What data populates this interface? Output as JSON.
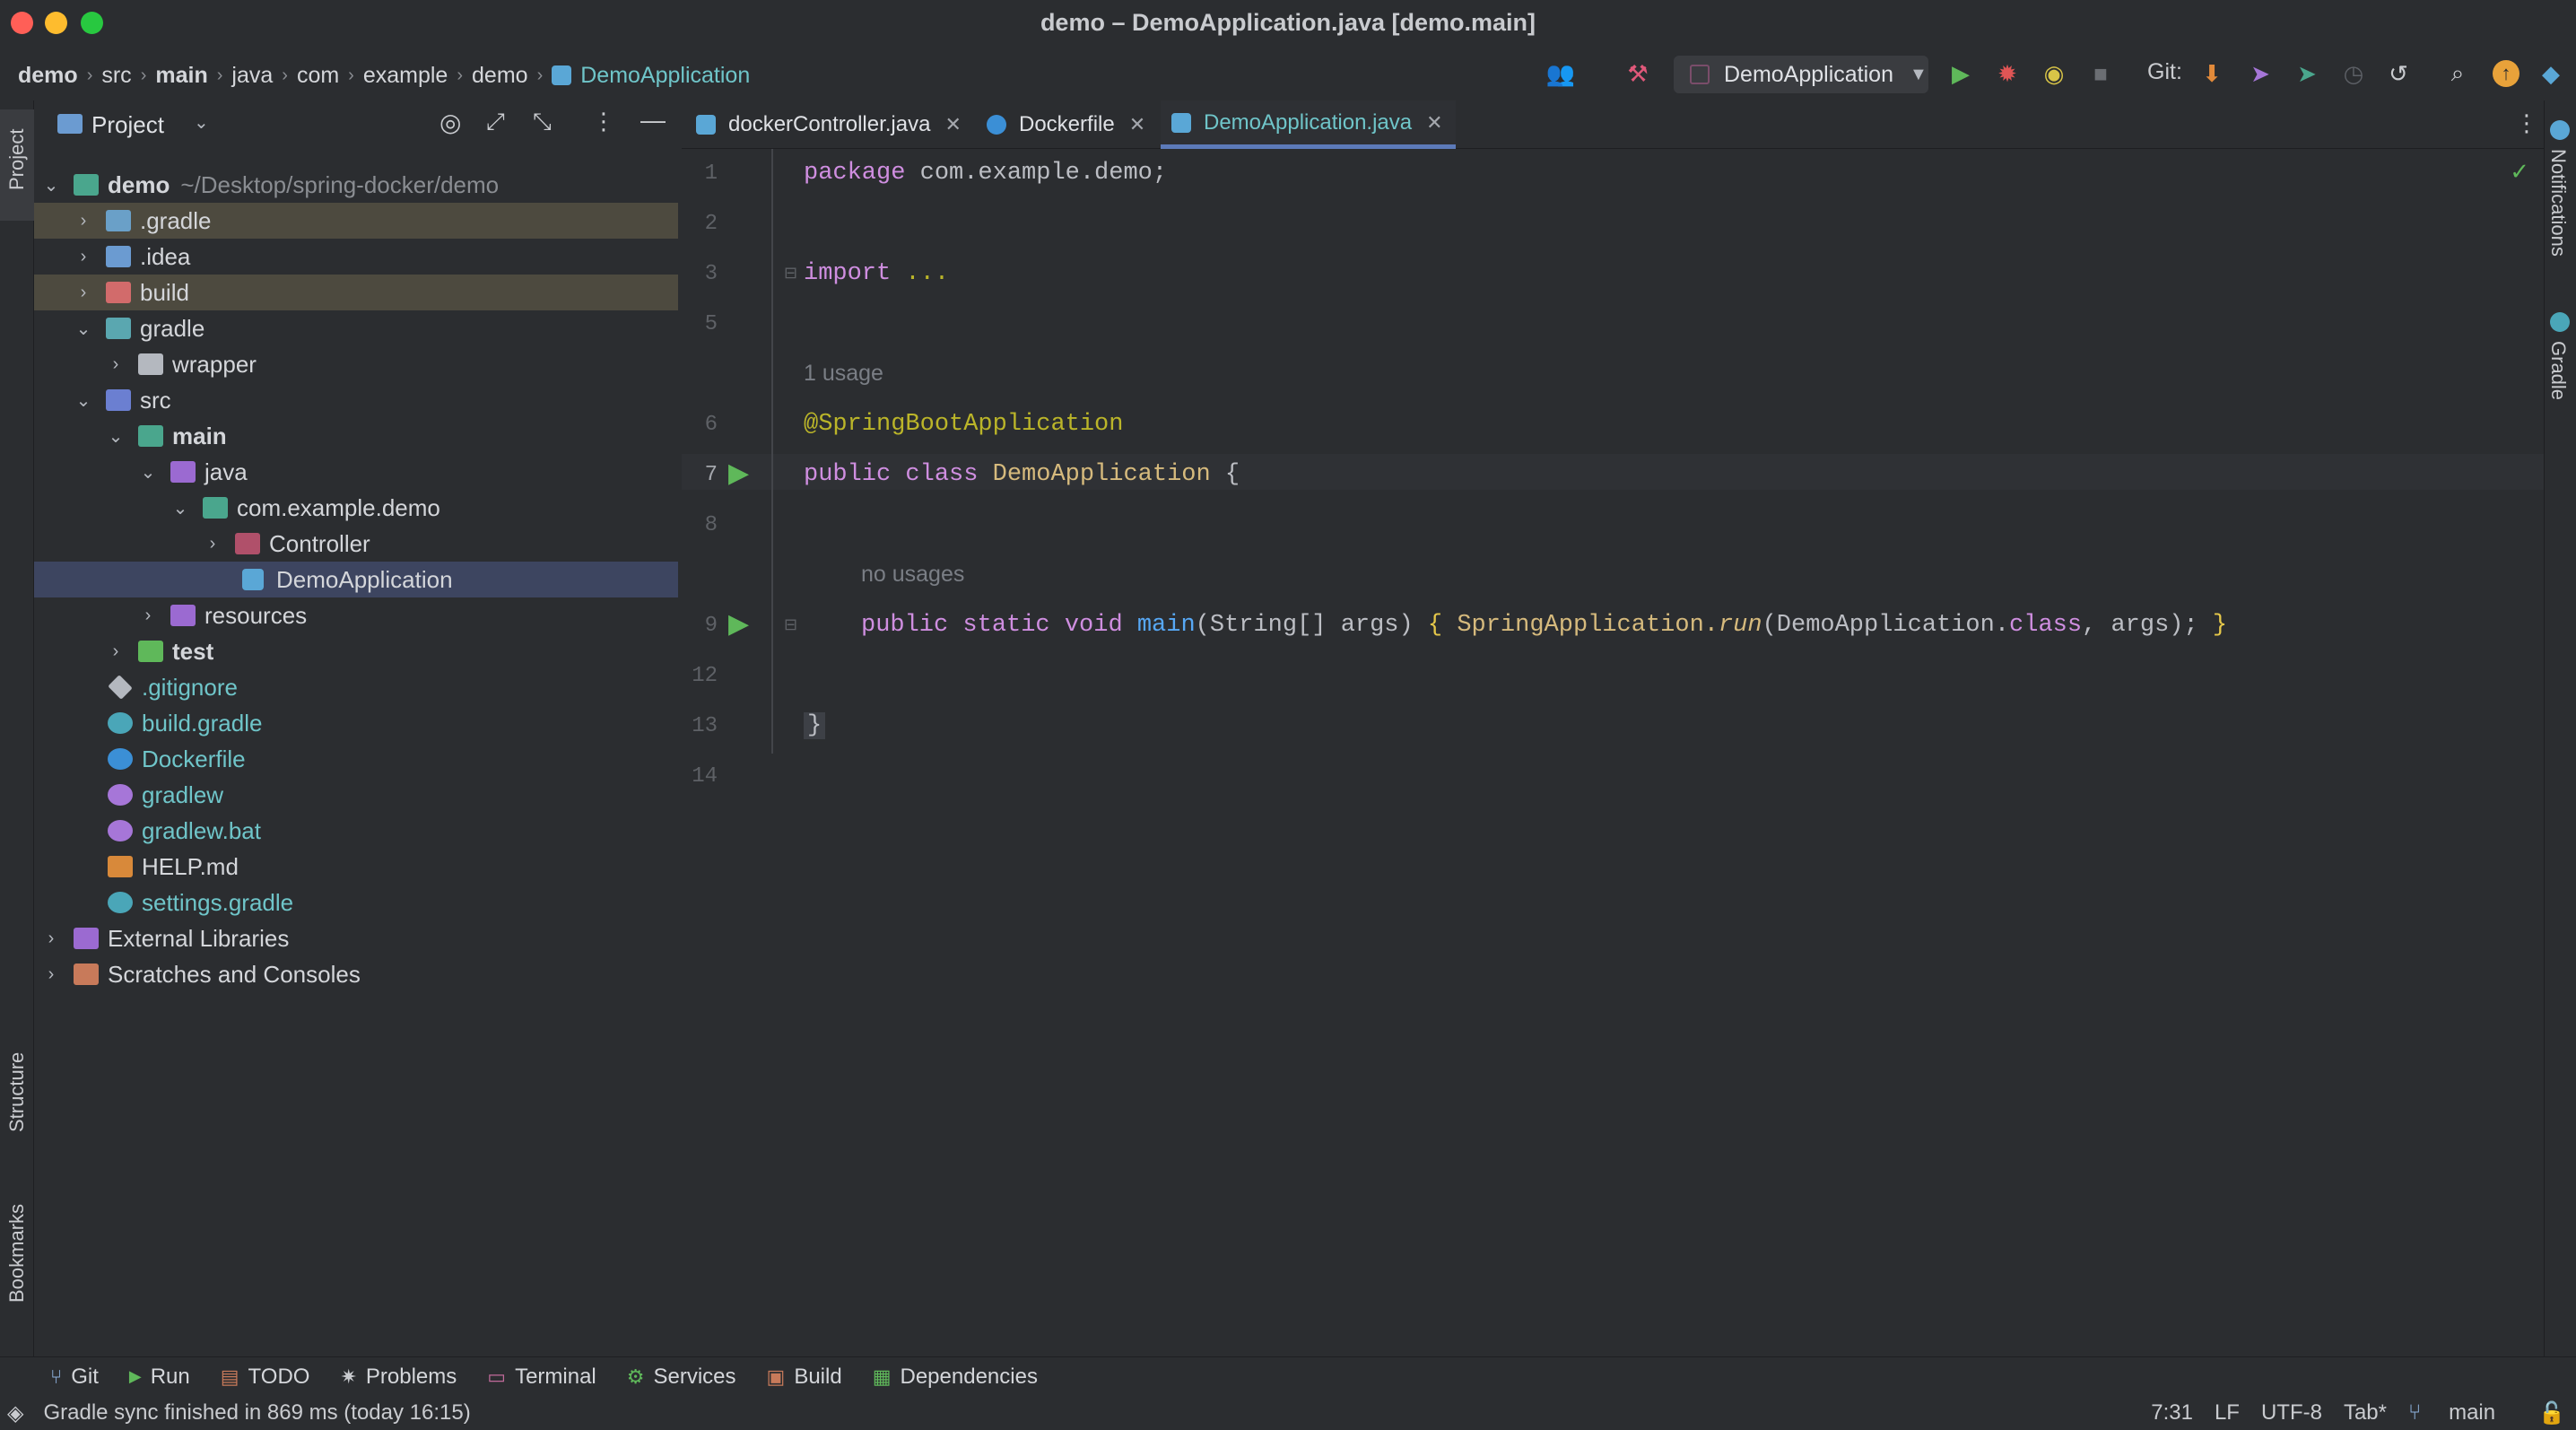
{
  "window": {
    "title": "demo – DemoApplication.java [demo.main]"
  },
  "breadcrumb": [
    "demo",
    "src",
    "main",
    "java",
    "com",
    "example",
    "demo",
    "DemoApplication"
  ],
  "toolbar": {
    "run_config": "DemoApplication",
    "git_label": "Git:"
  },
  "project_panel": {
    "title": "Project",
    "tree": [
      {
        "label": "demo",
        "path": "~/Desktop/spring-docker/demo"
      },
      {
        "label": ".gradle"
      },
      {
        "label": ".idea"
      },
      {
        "label": "build"
      },
      {
        "label": "gradle"
      },
      {
        "label": "wrapper"
      },
      {
        "label": "src"
      },
      {
        "label": "main"
      },
      {
        "label": "java"
      },
      {
        "label": "com.example.demo"
      },
      {
        "label": "Controller"
      },
      {
        "label": "DemoApplication"
      },
      {
        "label": "resources"
      },
      {
        "label": "test"
      },
      {
        "label": ".gitignore"
      },
      {
        "label": "build.gradle"
      },
      {
        "label": "Dockerfile"
      },
      {
        "label": "gradlew"
      },
      {
        "label": "gradlew.bat"
      },
      {
        "label": "HELP.md"
      },
      {
        "label": "settings.gradle"
      },
      {
        "label": "External Libraries"
      },
      {
        "label": "Scratches and Consoles"
      }
    ]
  },
  "left_strip": {
    "project": "Project",
    "structure": "Structure",
    "bookmarks": "Bookmarks"
  },
  "right_strip": {
    "notifications": "Notifications",
    "gradle": "Gradle"
  },
  "tabs": [
    {
      "label": "dockerController.java"
    },
    {
      "label": "Dockerfile"
    },
    {
      "label": "DemoApplication.java"
    }
  ],
  "editor": {
    "line_numbers": [
      "1",
      "2",
      "3",
      "5",
      "6",
      "7",
      "8",
      "9",
      "12",
      "13",
      "14"
    ],
    "hints": {
      "usage": "1 usage",
      "no_usages": "no usages"
    },
    "code": {
      "l1_kw": "package",
      "l1_rest": " com.example.demo;",
      "l3_kw": "import",
      "l3_rest": " ...",
      "l6": "@SpringBootApplication",
      "l7_kw": "public class",
      "l7_cls": " DemoApplication",
      "l7_rest": " {",
      "l9_kw": "public static void",
      "l9_fn": " main",
      "l9_a": "(String[] args) ",
      "l9_b": "{",
      "l9_c": " SpringApplication.",
      "l9_run": "run",
      "l9_d": "(DemoApplication.",
      "l9_e": "class",
      "l9_f": ", args); ",
      "l9_g": "}",
      "l13": "}"
    }
  },
  "bottom_tools": [
    "Git",
    "Run",
    "TODO",
    "Problems",
    "Terminal",
    "Services",
    "Build",
    "Dependencies"
  ],
  "status": {
    "message": "Gradle sync finished in 869 ms (today 16:15)",
    "position": "7:31",
    "line_sep": "LF",
    "encoding": "UTF-8",
    "indent": "Tab*",
    "branch": "main"
  }
}
